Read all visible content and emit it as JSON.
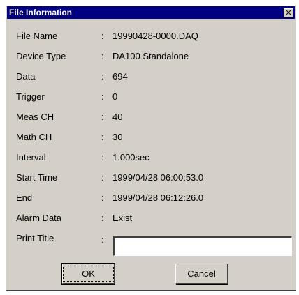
{
  "window": {
    "title": "File Information",
    "close_glyph": "✕"
  },
  "fields": [
    {
      "label": "File Name",
      "value": "19990428-0000.DAQ"
    },
    {
      "label": "Device Type",
      "value": "DA100 Standalone"
    },
    {
      "label": "Data",
      "value": "694"
    },
    {
      "label": "Trigger",
      "value": "0"
    },
    {
      "label": "Meas CH",
      "value": "40"
    },
    {
      "label": "Math CH",
      "value": "30"
    },
    {
      "label": "Interval",
      "value": "1.000sec"
    },
    {
      "label": "Start Time",
      "value": "1999/04/28 06:00:53.0"
    },
    {
      "label": "End",
      "value": "1999/04/28 06:12:26.0"
    },
    {
      "label": "Alarm Data",
      "value": "Exist"
    }
  ],
  "separator": ":",
  "print_title": {
    "label": "Print Title",
    "value": ""
  },
  "buttons": {
    "ok": "OK",
    "cancel": "Cancel"
  },
  "colors": {
    "titlebar": "#000080",
    "dialog_bg": "#d4d0c8"
  }
}
